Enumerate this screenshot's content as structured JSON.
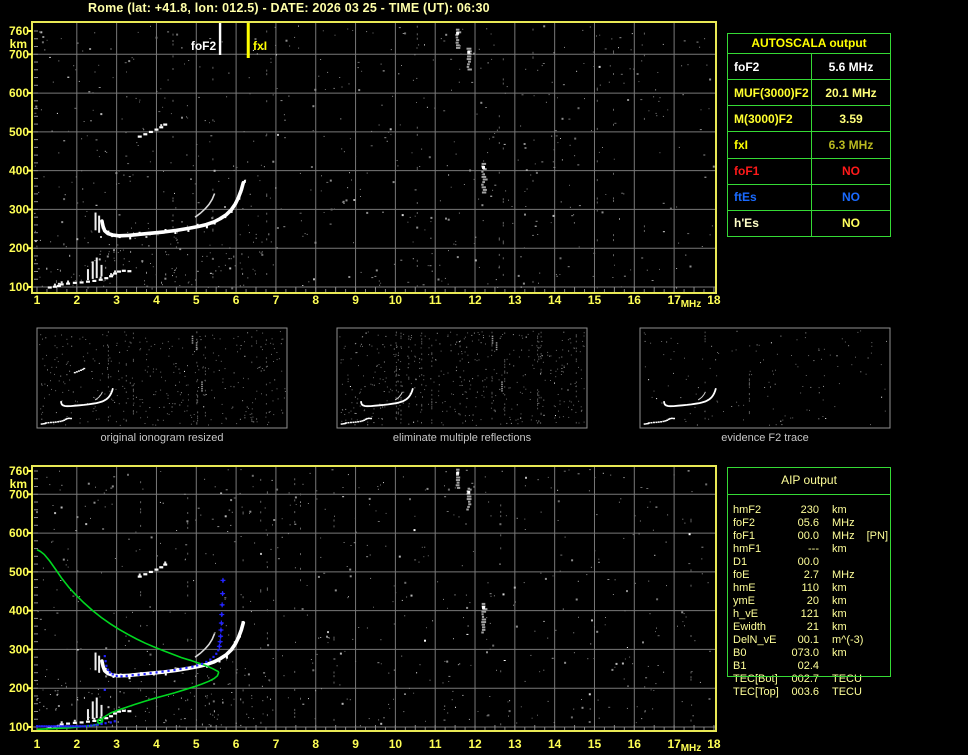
{
  "window": {
    "title": "Rome (lat: +41.8, lon: 012.5) - DATE: 2026 03 25 - TIME (UT): 06:30"
  },
  "colors": {
    "background": "#000000",
    "title": "#ffffa8",
    "axis_label": "#ffff55",
    "plot_border": "#e9e955",
    "grid": "#787878",
    "table_border": "#35da35",
    "aip_text": "#ffff99",
    "caption": "#c6c6c6",
    "trace_white": "#ffffff",
    "profile_green": "#00d820",
    "restored_blue": "#2424ff",
    "marker_foF2": "#ffffff",
    "marker_fxI": "#ffff00"
  },
  "autoscala_table": {
    "header": "AUTOSCALA output",
    "rows": [
      {
        "key": "fof2",
        "label": "foF2",
        "value": "5.6 MHz",
        "label_color": "#ffffff",
        "value_color": "#ffffff"
      },
      {
        "key": "muf3000f2",
        "label": "MUF(3000)F2",
        "value": "20.1 MHz",
        "label_color": "#ffff2e",
        "value_color": "#ffff7a"
      },
      {
        "key": "m3000f2",
        "label": "M(3000)F2",
        "value": "3.59",
        "label_color": "#ffff2e",
        "value_color": "#ffff7a"
      },
      {
        "key": "fxi",
        "label": "fxI",
        "value": "6.3 MHz",
        "label_color": "#ffff00",
        "value_color": "#b9b920"
      },
      {
        "key": "fof1",
        "label": "foF1",
        "value": "NO",
        "label_color": "#ff1a1a",
        "value_color": "#ff1a1a"
      },
      {
        "key": "ftes",
        "label": "ftEs",
        "value": "NO",
        "label_color": "#1a6aff",
        "value_color": "#1a6aff"
      },
      {
        "key": "hes",
        "label": "h'Es",
        "value": "NO",
        "label_color": "#ffffc8",
        "value_color": "#ffff5e"
      }
    ]
  },
  "aip_table": {
    "header": "AIP output",
    "rows": [
      {
        "name": "hmF2",
        "value": "230",
        "unit": "km",
        "extra": ""
      },
      {
        "name": "foF2",
        "value": "05.6",
        "unit": "MHz",
        "extra": ""
      },
      {
        "name": "foF1",
        "value": "00.0",
        "unit": "MHz",
        "extra": "[PN]"
      },
      {
        "name": "hmF1",
        "value": "---",
        "unit": "km",
        "extra": ""
      },
      {
        "name": "D1",
        "value": "00.0",
        "unit": "",
        "extra": ""
      },
      {
        "name": "foE",
        "value": "2.7",
        "unit": "MHz",
        "extra": ""
      },
      {
        "name": "hmE",
        "value": "110",
        "unit": "km",
        "extra": ""
      },
      {
        "name": "ymE",
        "value": "20",
        "unit": "km",
        "extra": ""
      },
      {
        "name": "h_vE",
        "value": "121",
        "unit": "km",
        "extra": ""
      },
      {
        "name": "Ewidth",
        "value": "21",
        "unit": "km",
        "extra": ""
      },
      {
        "name": "DelN_vE",
        "value": "00.1",
        "unit": "m^(-3)",
        "extra": ""
      },
      {
        "name": "B0",
        "value": "073.0",
        "unit": "km",
        "extra": ""
      },
      {
        "name": "B1",
        "value": "02.4",
        "unit": "",
        "extra": ""
      },
      {
        "name": "TEC[Bot]",
        "value": "002.7",
        "unit": "TECU",
        "extra": ""
      },
      {
        "name": "TEC[Top]",
        "value": "003.6",
        "unit": "TECU",
        "extra": ""
      }
    ]
  },
  "thumbnails": [
    {
      "caption": "original ionogram resized",
      "seed": 11,
      "noise": 360,
      "streaks": 8,
      "second_hop": true,
      "interference": true
    },
    {
      "caption": "eliminate multiple reflections",
      "seed": 23,
      "noise": 430,
      "streaks": 14,
      "second_hop": false,
      "interference": true
    },
    {
      "caption": "evidence F2 trace",
      "seed": 37,
      "noise": 130,
      "streaks": 2,
      "second_hop": false,
      "interference": false
    }
  ],
  "chart_data": [
    {
      "id": "top-ionogram",
      "type": "scatter",
      "title": "scaled ionogram with AUTOSCALA characteristic markers",
      "xlabel": "MHz",
      "ylabel": "km",
      "xlim": [
        1,
        18
      ],
      "ylim": [
        90,
        770
      ],
      "xticks": [
        1,
        2,
        3,
        4,
        5,
        6,
        7,
        8,
        9,
        10,
        11,
        12,
        13,
        14,
        15,
        16,
        17,
        18
      ],
      "yticks": [
        100,
        200,
        300,
        400,
        500,
        600,
        700,
        760
      ],
      "grid": true,
      "noise_seed": 7,
      "noise_count": 620,
      "markers": [
        {
          "name": "foF2",
          "f": 5.6,
          "color": "#ffffff",
          "side": "left"
        },
        {
          "name": "fxI",
          "f": 6.3,
          "color": "#ffff00",
          "side": "right"
        }
      ],
      "series": [
        {
          "name": "E-layer-trace",
          "style": "dash",
          "points": [
            [
              1.32,
              99
            ],
            [
              1.45,
              101
            ],
            [
              1.55,
              103
            ],
            [
              1.62,
              107
            ],
            [
              1.78,
              109
            ],
            [
              1.95,
              111
            ],
            [
              2.12,
              112
            ],
            [
              2.28,
              114
            ],
            [
              2.44,
              116
            ],
            [
              2.6,
              119
            ],
            [
              2.74,
              123
            ],
            [
              2.86,
              128
            ],
            [
              2.96,
              135
            ],
            [
              3.06,
              140
            ],
            [
              3.18,
              142
            ],
            [
              3.32,
              141
            ]
          ]
        },
        {
          "name": "E-layer-retardation-spikes",
          "style": "vseg",
          "segments": [
            [
              2.28,
              118,
              146
            ],
            [
              2.4,
              121,
              166
            ],
            [
              2.5,
              123,
              176
            ],
            [
              2.62,
              127,
              157
            ]
          ]
        },
        {
          "name": "F-trace-retardation",
          "style": "vseg",
          "segments": [
            [
              2.47,
              246,
              292
            ],
            [
              2.56,
              240,
              284
            ]
          ]
        },
        {
          "name": "F-layer-trace",
          "style": "line4",
          "points": [
            [
              2.63,
              270
            ],
            [
              2.66,
              256
            ],
            [
              2.7,
              245
            ],
            [
              2.78,
              238
            ],
            [
              2.9,
              234
            ],
            [
              3.05,
              232
            ],
            [
              3.3,
              233
            ],
            [
              3.6,
              236
            ],
            [
              3.9,
              239
            ],
            [
              4.2,
              242
            ],
            [
              4.5,
              246
            ],
            [
              4.8,
              251
            ],
            [
              5.05,
              256
            ],
            [
              5.25,
              261
            ],
            [
              5.45,
              268
            ],
            [
              5.6,
              276
            ],
            [
              5.75,
              286
            ],
            [
              5.88,
              299
            ],
            [
              5.98,
              314
            ],
            [
              6.06,
              331
            ],
            [
              6.13,
              350
            ],
            [
              6.18,
              369
            ]
          ]
        },
        {
          "name": "F-trace-O-mode-cusp",
          "style": "line2",
          "points": [
            [
              4.97,
              280
            ],
            [
              5.1,
              290
            ],
            [
              5.22,
              301
            ],
            [
              5.32,
              313
            ],
            [
              5.4,
              326
            ],
            [
              5.46,
              341
            ]
          ]
        },
        {
          "name": "second-hop-echo",
          "style": "dash",
          "points": [
            [
              3.58,
              488
            ],
            [
              3.72,
              494
            ],
            [
              3.86,
              500
            ],
            [
              4.0,
              506
            ],
            [
              4.12,
              512
            ],
            [
              4.22,
              519
            ]
          ]
        },
        {
          "name": "interference-streaks",
          "style": "streak",
          "segments": [
            [
              11.55,
              714,
              766
            ],
            [
              11.83,
              663,
              717
            ],
            [
              12.2,
              345,
              420
            ]
          ]
        }
      ]
    },
    {
      "id": "bottom-ionogram",
      "type": "scatter",
      "title": "ionogram with AIP restored trace and electron density profile",
      "xlabel": "MHz",
      "ylabel": "km",
      "xlim": [
        1,
        18
      ],
      "ylim": [
        90,
        770
      ],
      "xticks": [
        1,
        2,
        3,
        4,
        5,
        6,
        7,
        8,
        9,
        10,
        11,
        12,
        13,
        14,
        15,
        16,
        17,
        18
      ],
      "yticks": [
        100,
        200,
        300,
        400,
        500,
        600,
        700,
        760
      ],
      "grid": true,
      "noise_seed": 13,
      "noise_count": 560,
      "inherit_series_from": 0,
      "series": [
        {
          "name": "electron-density-profile",
          "style": "line-green",
          "points": [
            [
              1.0,
              94
            ],
            [
              1.4,
              96
            ],
            [
              1.8,
              98
            ],
            [
              2.15,
              101
            ],
            [
              2.4,
              104
            ],
            [
              2.55,
              108
            ],
            [
              2.64,
              113
            ],
            [
              2.65,
              118
            ],
            [
              2.58,
              121
            ],
            [
              2.52,
              117
            ],
            [
              2.53,
              112
            ],
            [
              2.59,
              109
            ],
            [
              2.66,
              124
            ],
            [
              2.85,
              136
            ],
            [
              3.05,
              144
            ],
            [
              3.25,
              151
            ],
            [
              3.45,
              158
            ],
            [
              3.7,
              166
            ],
            [
              3.95,
              174
            ],
            [
              4.2,
              181
            ],
            [
              4.45,
              188
            ],
            [
              4.7,
              196
            ],
            [
              4.95,
              204
            ],
            [
              5.15,
              211
            ],
            [
              5.32,
              218
            ],
            [
              5.45,
              225
            ],
            [
              5.53,
              232
            ],
            [
              5.56,
              240
            ],
            [
              5.55,
              243
            ],
            [
              5.42,
              250
            ],
            [
              5.25,
              258
            ],
            [
              5.05,
              265
            ],
            [
              4.85,
              272
            ],
            [
              4.63,
              279
            ],
            [
              4.4,
              288
            ],
            [
              4.17,
              297
            ],
            [
              3.95,
              306
            ],
            [
              3.72,
              316
            ],
            [
              3.5,
              327
            ],
            [
              3.28,
              339
            ],
            [
              3.06,
              352
            ],
            [
              2.84,
              366
            ],
            [
              2.62,
              382
            ],
            [
              2.4,
              400
            ],
            [
              2.18,
              420
            ],
            [
              1.98,
              440
            ],
            [
              1.8,
              460
            ],
            [
              1.63,
              482
            ],
            [
              1.47,
              506
            ],
            [
              1.32,
              528
            ],
            [
              1.18,
              545
            ],
            [
              1.08,
              553
            ],
            [
              1.0,
              557
            ]
          ]
        },
        {
          "name": "restored-trace",
          "style": "dots-blue",
          "points": [
            [
              1.0,
              102
            ],
            [
              1.06,
              102
            ],
            [
              1.12,
              102
            ],
            [
              1.18,
              102
            ],
            [
              1.24,
              102
            ],
            [
              1.3,
              102
            ],
            [
              1.36,
              102
            ],
            [
              1.42,
              102
            ],
            [
              1.48,
              102
            ],
            [
              1.54,
              102
            ],
            [
              1.6,
              102
            ],
            [
              1.66,
              102
            ],
            [
              1.72,
              102
            ],
            [
              1.78,
              102
            ],
            [
              1.84,
              102
            ],
            [
              1.9,
              102
            ],
            [
              1.96,
              102
            ],
            [
              2.02,
              102
            ],
            [
              2.08,
              102
            ],
            [
              2.14,
              102
            ],
            [
              2.2,
              102
            ],
            [
              2.28,
              103
            ],
            [
              2.36,
              104
            ],
            [
              2.44,
              105
            ],
            [
              2.52,
              106
            ],
            [
              2.62,
              108
            ],
            [
              2.72,
              110
            ],
            [
              2.85,
              112
            ],
            [
              2.95,
              115
            ],
            [
              2.7,
              196
            ],
            [
              2.7,
              283
            ],
            [
              2.72,
              270
            ],
            [
              2.74,
              258
            ],
            [
              2.78,
              248
            ],
            [
              2.83,
              241
            ],
            [
              2.9,
              236
            ],
            [
              3.0,
              232
            ],
            [
              3.12,
              231
            ],
            [
              3.25,
              232
            ],
            [
              3.4,
              234
            ],
            [
              3.55,
              235
            ],
            [
              3.7,
              237
            ],
            [
              3.85,
              239
            ],
            [
              4.0,
              241
            ],
            [
              4.15,
              243
            ],
            [
              4.3,
              245
            ],
            [
              4.45,
              247
            ],
            [
              4.6,
              250
            ],
            [
              4.75,
              253
            ],
            [
              4.9,
              256
            ],
            [
              5.02,
              259
            ],
            [
              5.14,
              263
            ],
            [
              5.25,
              268
            ],
            [
              5.35,
              274
            ],
            [
              5.43,
              281
            ],
            [
              5.5,
              289
            ],
            [
              5.55,
              298
            ],
            [
              5.58,
              308
            ],
            [
              5.6,
              320
            ],
            [
              5.61,
              334
            ],
            [
              5.62,
              350
            ],
            [
              5.63,
              368
            ],
            [
              5.64,
              390
            ],
            [
              5.65,
              415
            ],
            [
              5.66,
              444
            ],
            [
              5.67,
              478
            ]
          ]
        }
      ]
    }
  ]
}
